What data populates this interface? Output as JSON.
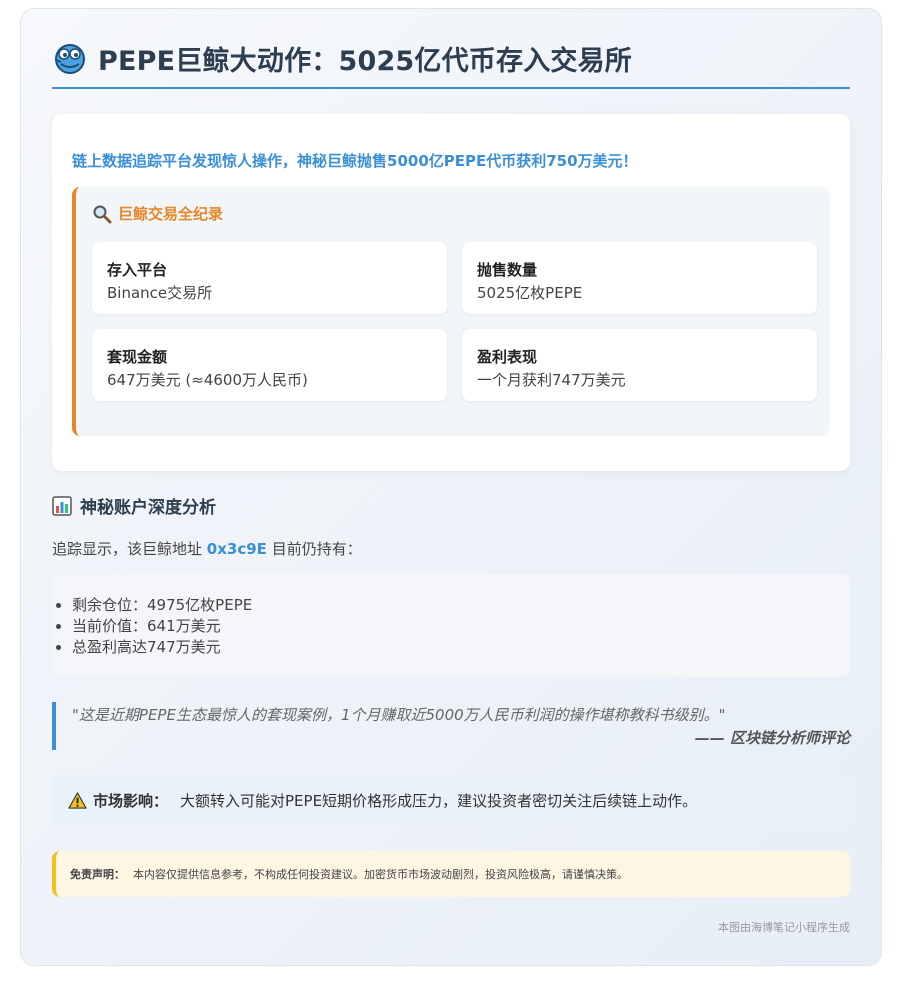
{
  "header": {
    "title": "PEPE巨鲸大动作：5025亿代币存入交易所",
    "logo_icon": "frog-icon"
  },
  "intro": {
    "text": "链上数据追踪平台发现惊人操作，神秘巨鲸抛售5000亿PEPE代币获利750万美元！",
    "record_title": "巨鲸交易全纪录",
    "record_icon": "magnifier-icon",
    "cells": [
      {
        "label": "存入平台",
        "value": "Binance交易所"
      },
      {
        "label": "抛售数量",
        "value": "5025亿枚PEPE"
      },
      {
        "label": "套现金额",
        "value": "647万美元 (≈4600万人民币)"
      },
      {
        "label": "盈利表现",
        "value": "一个月获利747万美元"
      }
    ]
  },
  "analysis": {
    "title": "神秘账户深度分析",
    "icon": "bar-chart-icon",
    "track_prefix": "追踪显示，该巨鲸地址",
    "address": "0x3c9E",
    "track_suffix": "目前仍持有：",
    "holdings": [
      "剩余仓位：4975亿枚PEPE",
      "当前价值：641万美元",
      "总盈利高达747万美元"
    ]
  },
  "quote": {
    "text": "\"这是近期PEPE生态最惊人的套现案例，1个月赚取近5000万人民币利润的操作堪称教科书级别。\"",
    "source": "—— 区块链分析师评论"
  },
  "impact": {
    "icon": "warning-icon",
    "label": "市场影响：",
    "text": "大额转入可能对PEPE短期价格形成压力，建议投资者密切关注后续链上动作。"
  },
  "disclaimer": {
    "label": "免责声明：",
    "text": "本内容仅提供信息参考，不构成任何投资建议。加密货币市场波动剧烈，投资风险极高，请谨慎决策。"
  },
  "footer": {
    "text": "本图由海博笔记小程序生成"
  },
  "colors": {
    "accent": "#3a8fd6",
    "orange": "#e6862a",
    "yellow": "#f4c020",
    "title": "#2c3e50"
  }
}
